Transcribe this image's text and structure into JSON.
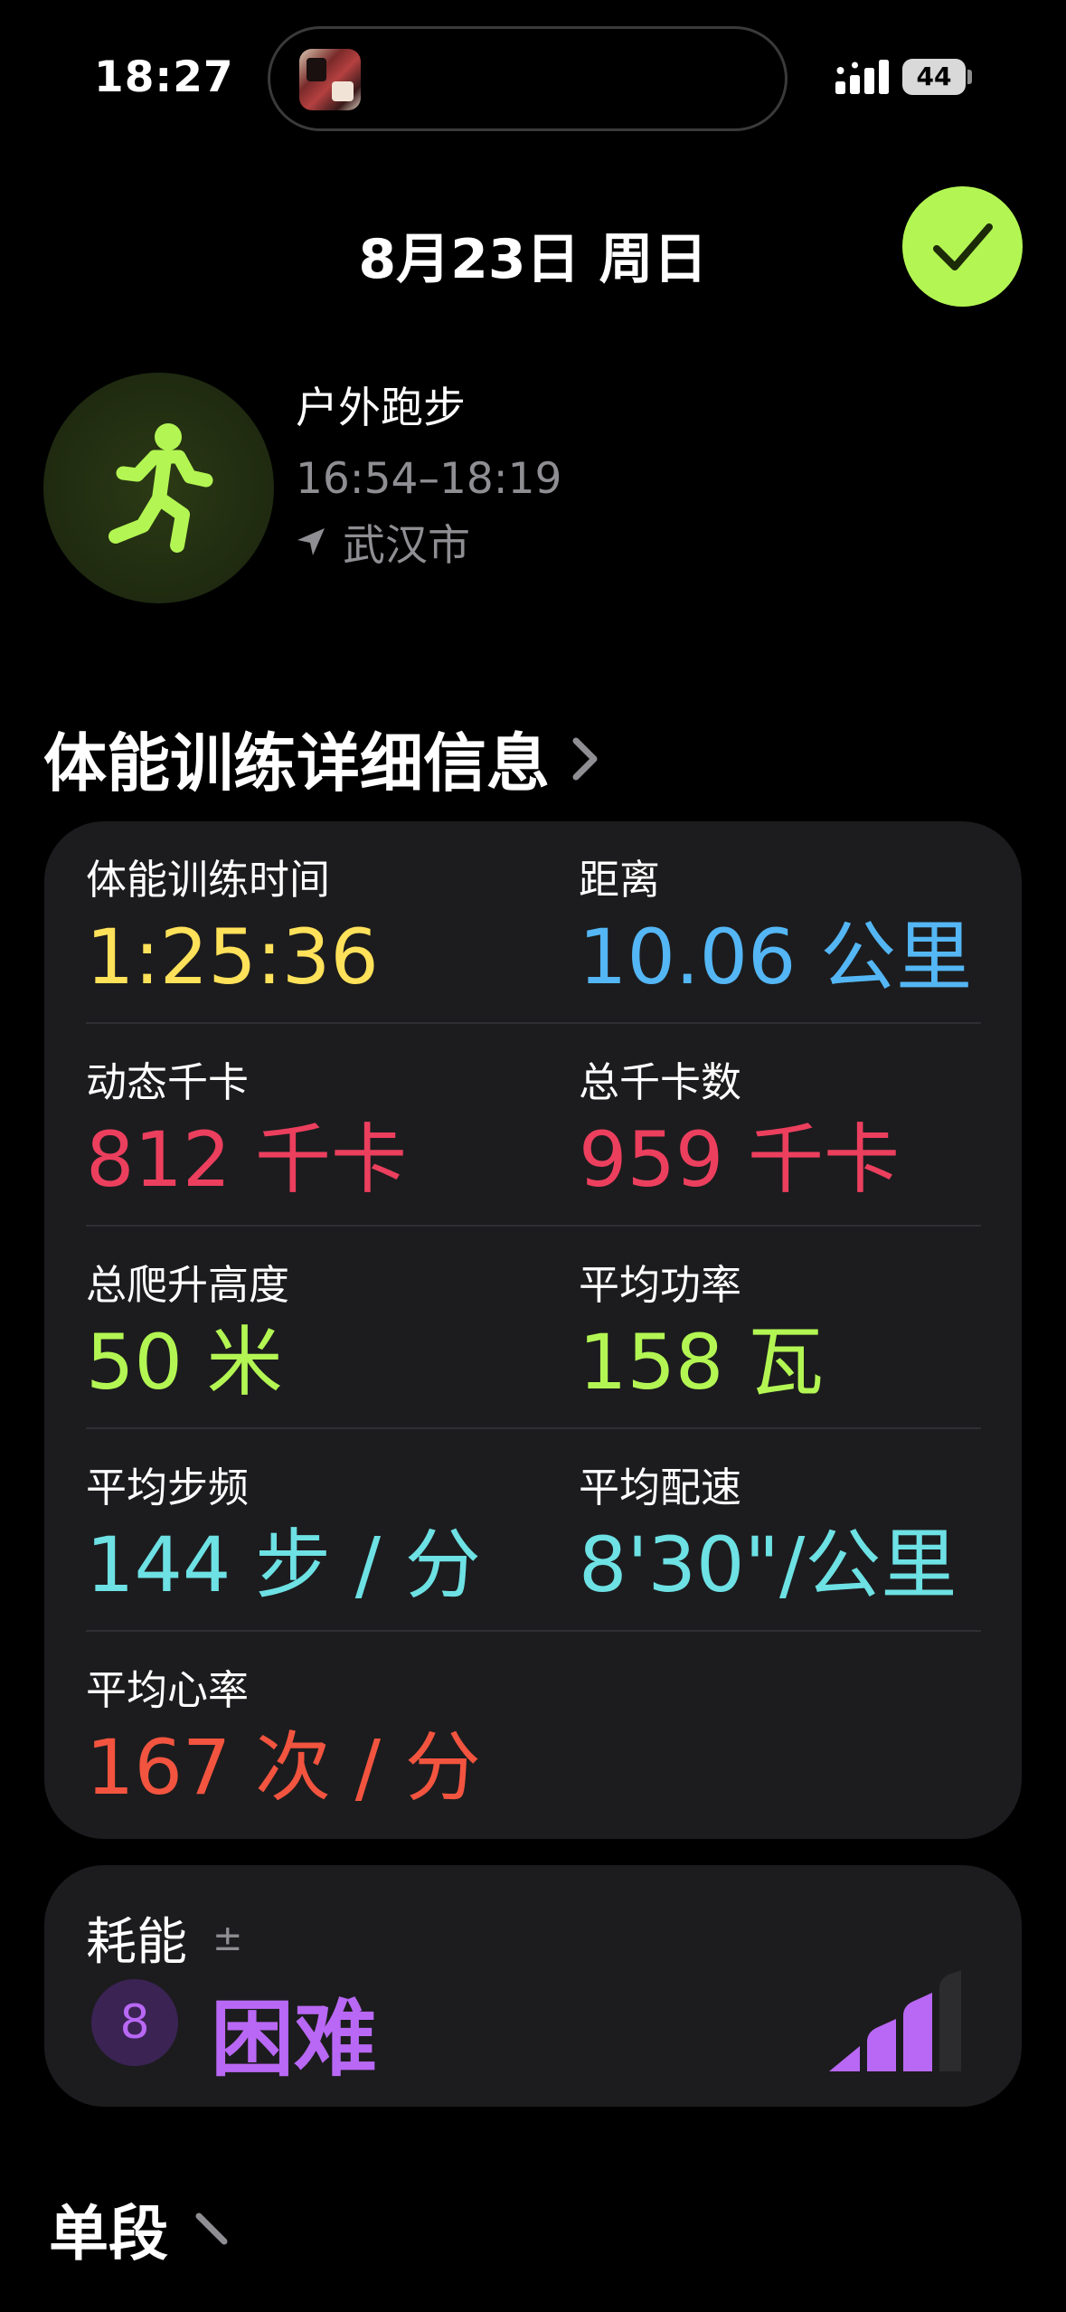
{
  "status_bar": {
    "time": "18:27",
    "battery": "44"
  },
  "header": {
    "date": "8月23日 周日"
  },
  "workout": {
    "name": "户外跑步",
    "time_range": "16:54–18:19",
    "location": "武汉市",
    "accent_color": "#b3f653"
  },
  "details": {
    "title": "体能训练详细信息",
    "metrics": [
      {
        "label": "体能训练时间",
        "value": "1:25:36",
        "color": "#ffe15a"
      },
      {
        "label": "距离",
        "value": "10.06 公里",
        "color": "#54b6f4"
      },
      {
        "label": "动态千卡",
        "value": "812 千卡",
        "color": "#ec3f5e"
      },
      {
        "label": "总千卡数",
        "value": "959 千卡",
        "color": "#ec3f5e"
      },
      {
        "label": "总爬升高度",
        "value": "50 米",
        "color": "#b3f653"
      },
      {
        "label": "平均功率",
        "value": "158 瓦",
        "color": "#b3f653"
      },
      {
        "label": "平均步频",
        "value": "144 步 / 分",
        "color": "#6de1e4"
      },
      {
        "label": "平均配速",
        "value": "8'30\"/公里",
        "color": "#6de1e4"
      },
      {
        "label": "平均心率",
        "value": "167 次 / 分",
        "color": "#f2543f"
      }
    ]
  },
  "effort": {
    "label": "耗能",
    "adjust_symbol": "±",
    "score": "8",
    "level": "困难",
    "color": "#b968f5"
  },
  "next_section": {
    "title": "单段"
  }
}
